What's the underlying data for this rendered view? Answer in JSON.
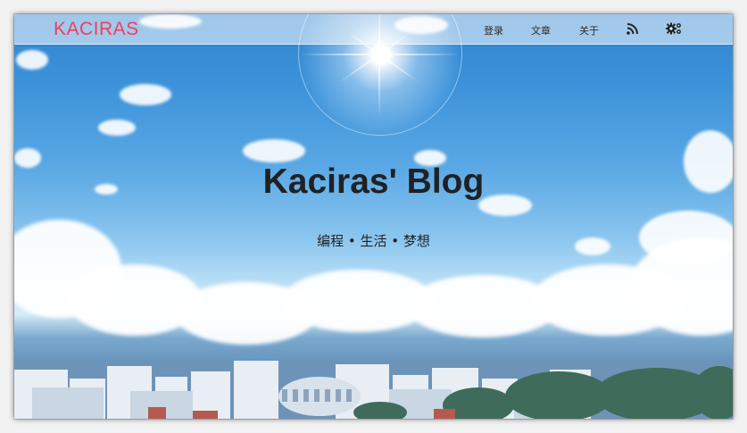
{
  "brand": {
    "name": "KACIRAS"
  },
  "nav": {
    "items": [
      {
        "label": "登录"
      },
      {
        "label": "文章"
      },
      {
        "label": "关于"
      }
    ],
    "icons": [
      "rss-icon",
      "settings-icon"
    ]
  },
  "hero": {
    "title": "Kaciras' Blog",
    "subtitle": "编程 • 生活 • 梦想"
  },
  "colors": {
    "brand": "#ef3f5e",
    "text": "#1f2125",
    "sky_top": "#2f84cf",
    "sky_horizon": "#d7ecf8"
  }
}
